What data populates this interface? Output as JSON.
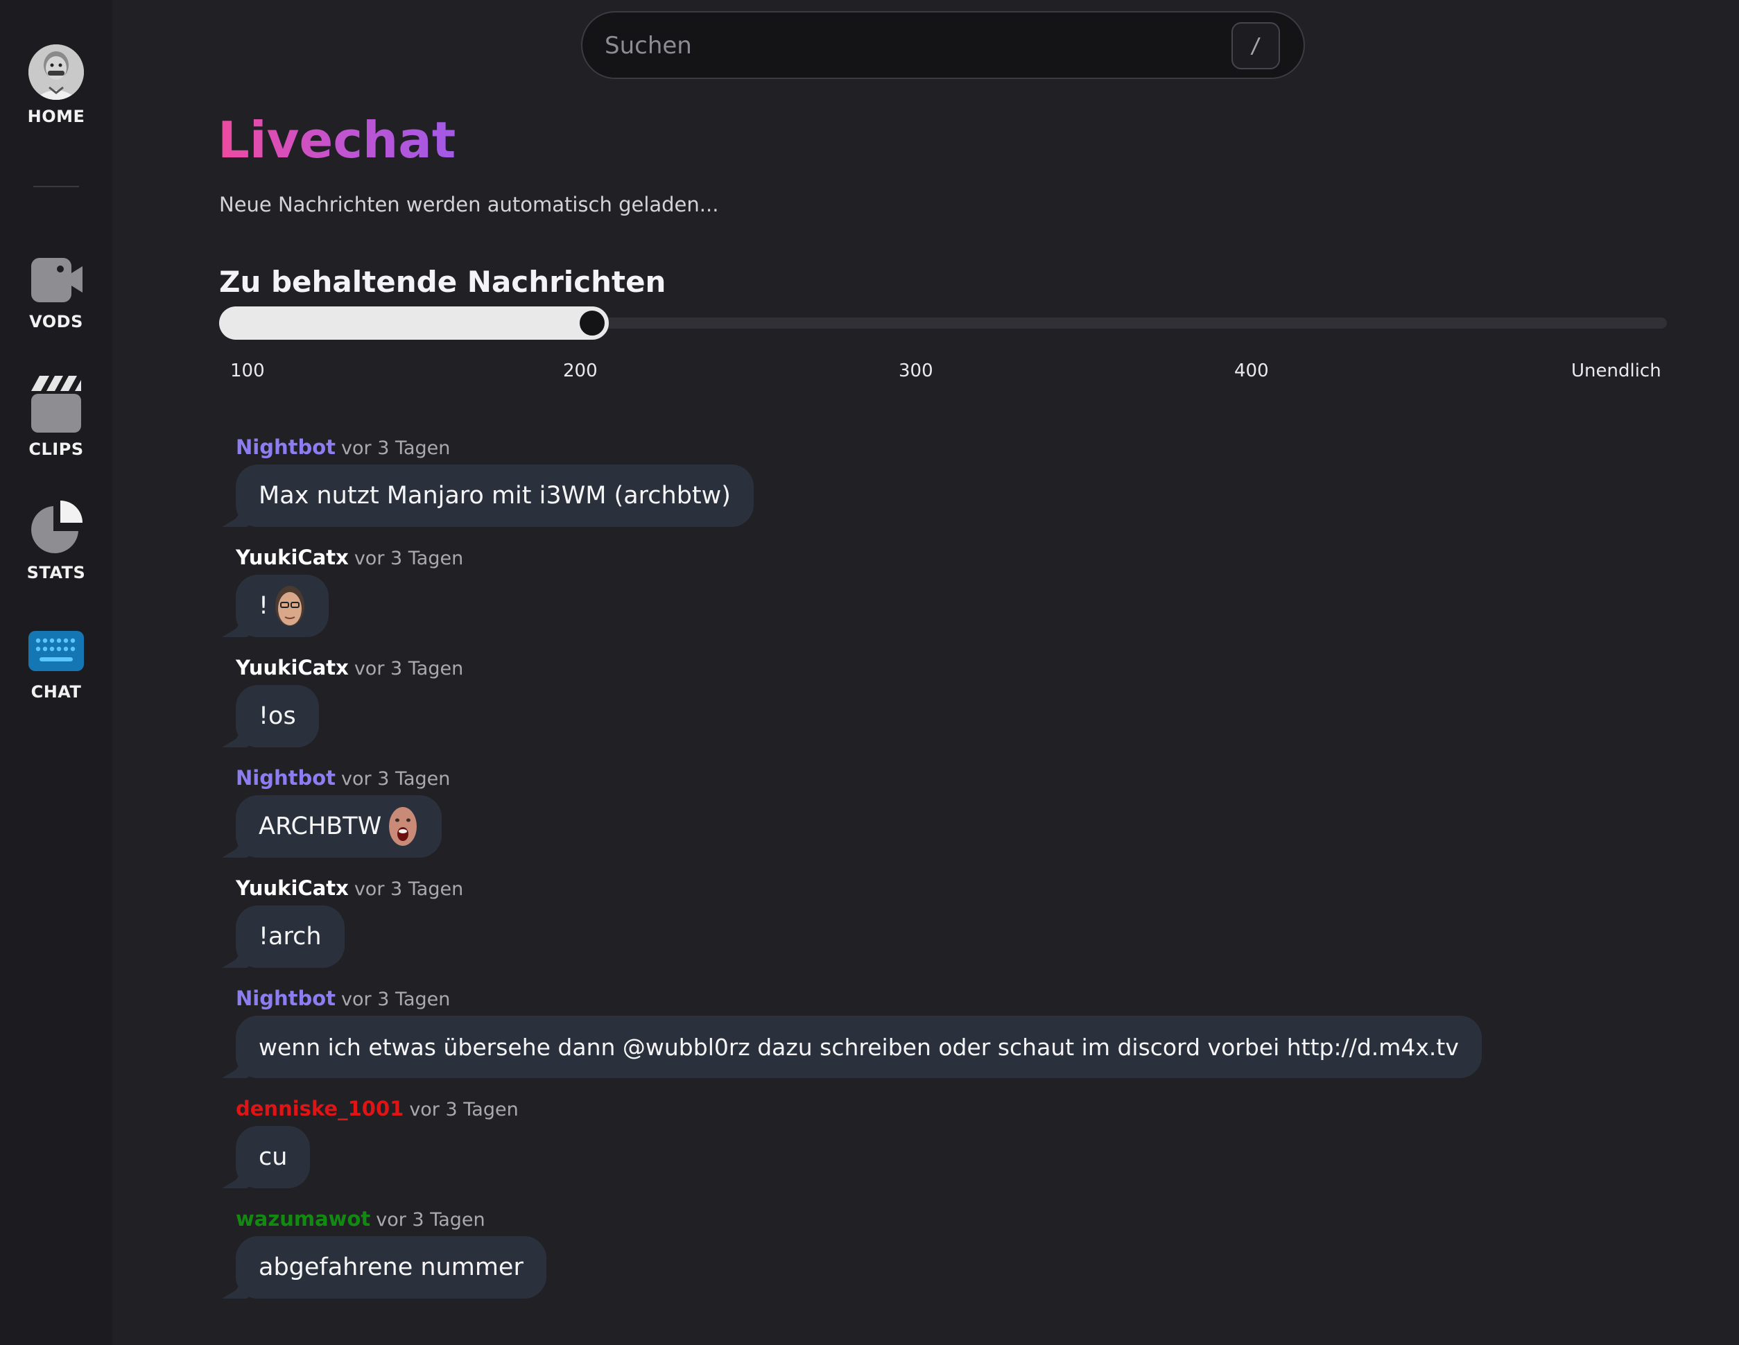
{
  "sidebar": {
    "items": [
      {
        "label": "HOME",
        "icon": "avatar"
      },
      {
        "label": "VODS",
        "icon": "video-camera-icon"
      },
      {
        "label": "CLIPS",
        "icon": "clapperboard-icon"
      },
      {
        "label": "STATS",
        "icon": "pie-chart-icon"
      },
      {
        "label": "CHAT",
        "icon": "keyboard-icon",
        "active": true
      }
    ],
    "active_color": "#1e9ee8",
    "icon_color": "#8e8e92"
  },
  "search": {
    "placeholder": "Suchen",
    "shortcut": "/"
  },
  "header": {
    "title": "Livechat",
    "subtitle": "Neue Nachrichten werden automatisch geladen..."
  },
  "retention": {
    "label": "Zu behaltende Nachrichten",
    "ticks": [
      "100",
      "200",
      "300",
      "400",
      "Unendlich"
    ],
    "selected": "200",
    "selected_fraction": 0.25
  },
  "messages": [
    {
      "author": "Nightbot",
      "color": "#8c7ef0",
      "time": "vor 3 Tagen",
      "text": "Max nutzt Manjaro mit i3WM (archbtw)"
    },
    {
      "author": "YuukiCatx",
      "color": "#ffffff",
      "time": "vor 3 Tagen",
      "text": "!",
      "emote": "face-emote"
    },
    {
      "author": "YuukiCatx",
      "color": "#ffffff",
      "time": "vor 3 Tagen",
      "text": "!os"
    },
    {
      "author": "Nightbot",
      "color": "#8c7ef0",
      "time": "vor 3 Tagen",
      "text": "ARCHBTW",
      "emote": "shouting-face-emote"
    },
    {
      "author": "YuukiCatx",
      "color": "#ffffff",
      "time": "vor 3 Tagen",
      "text": "!arch"
    },
    {
      "author": "Nightbot",
      "color": "#8c7ef0",
      "time": "vor 3 Tagen",
      "text": "wenn ich etwas übersehe dann @wubbl0rz dazu schreiben oder schaut im discord vorbei http://d.m4x.tv"
    },
    {
      "author": "denniske_1001",
      "color": "#e01414",
      "time": "vor 3 Tagen",
      "text": "cu"
    },
    {
      "author": "wazumawot",
      "color": "#128a12",
      "time": "vor 3 Tagen",
      "text": "abgefahrene nummer"
    }
  ]
}
